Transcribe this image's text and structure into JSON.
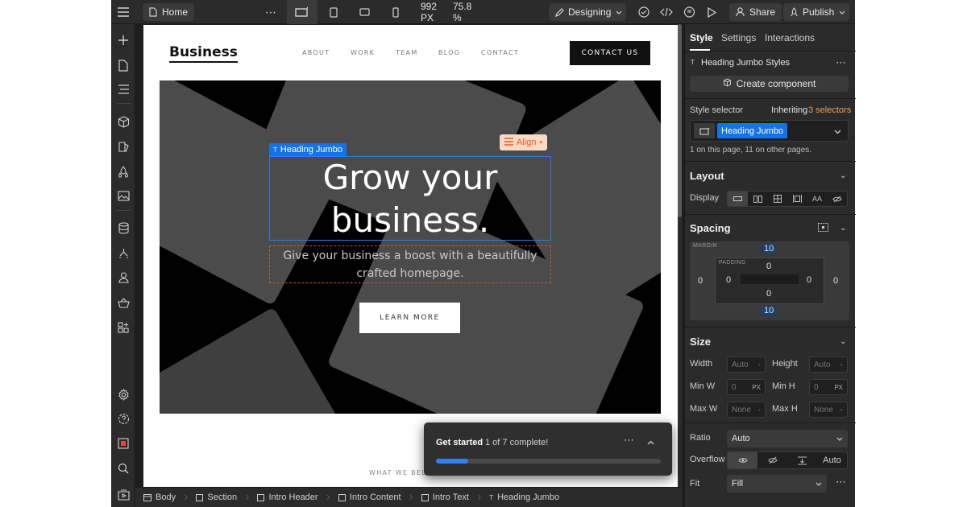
{
  "topbar": {
    "page_name": "Home",
    "width_label": "992 PX",
    "zoom_label": "75.8 %",
    "mode_label": "Designing",
    "share_label": "Share",
    "publish_label": "Publish"
  },
  "site": {
    "brand": "Business",
    "nav": [
      "ABOUT",
      "WORK",
      "TEAM",
      "BLOG",
      "CONTACT"
    ],
    "contact_button": "CONTACT US",
    "hero_title": "Grow your business.",
    "hero_subtitle": "Give your business a boost with a beautifully crafted homepage.",
    "learn_more": "LEARN MORE",
    "section_label": "WHAT WE BEL"
  },
  "selection": {
    "tag_label": "Heading Jumbo",
    "align_label": "Align"
  },
  "get_started": {
    "title": "Get started",
    "progress_text": "1 of 7 complete!",
    "progress_fraction": 0.143
  },
  "breadcrumbs": [
    "Body",
    "Section",
    "Intro Header",
    "Intro Content",
    "Intro Text",
    "Heading Jumbo"
  ],
  "panel": {
    "tabs": [
      "Style",
      "Settings",
      "Interactions"
    ],
    "styles_header": "Heading Jumbo Styles",
    "create_component": "Create component",
    "style_selector_label": "Style selector",
    "inheriting_label": "Inheriting",
    "inheriting_count": "3 selectors",
    "selector_chip": "Heading Jumbo",
    "selector_usage": "1 on this page, 11 on other pages.",
    "layout": {
      "header": "Layout",
      "display_label": "Display",
      "display_options": [
        "block",
        "flex",
        "grid",
        "inline-block",
        "inline",
        "none"
      ],
      "display_selected": "block"
    },
    "spacing": {
      "header": "Spacing",
      "margin_caption": "MARGIN",
      "padding_caption": "PADDING",
      "margin_top": "10",
      "margin_bottom": "10",
      "margin_left": "0",
      "margin_right": "0",
      "padding_top": "0",
      "padding_bottom": "0",
      "padding_left": "0",
      "padding_right": "0"
    },
    "size": {
      "header": "Size",
      "width_label": "Width",
      "width_value": "Auto",
      "height_label": "Height",
      "height_value": "Auto",
      "minw_label": "Min W",
      "minw_value": "0",
      "minw_unit": "PX",
      "minh_label": "Min H",
      "minh_value": "0",
      "minh_unit": "PX",
      "maxw_label": "Max W",
      "maxw_value": "None",
      "maxh_label": "Max H",
      "maxh_value": "None",
      "unit_dash": "-",
      "ratio_label": "Ratio",
      "ratio_value": "Auto",
      "overflow_label": "Overflow",
      "overflow_auto": "Auto",
      "fit_label": "Fit",
      "fit_value": "Fill"
    }
  }
}
